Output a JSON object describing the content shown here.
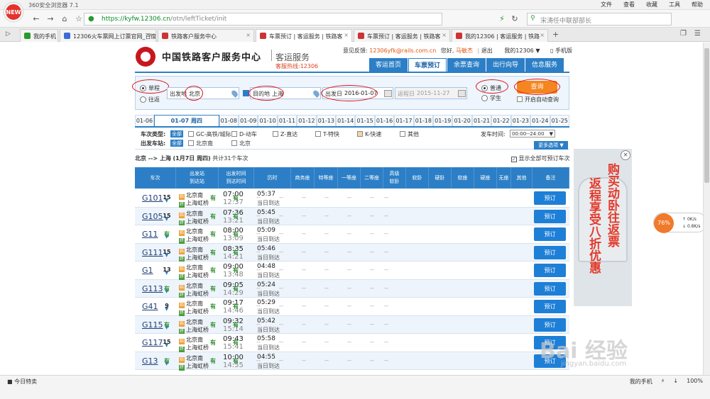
{
  "browser": {
    "title": "360安全浏览器 7.1",
    "logo_text": "NEW",
    "menu": [
      "文件",
      "查看",
      "收藏",
      "工具",
      "帮助"
    ],
    "url_host": "https://kyfw.12306.cn",
    "url_path": "/otn/leftTicket/init",
    "search_placeholder": "宋涛任中联部部长",
    "tabs": [
      {
        "label": "我的手机"
      },
      {
        "label": "12306火车票网上订票官网_百度"
      },
      {
        "label": "铁路客户服务中心"
      },
      {
        "label": "车票预订 | 客运服务 | 铁路客"
      },
      {
        "label": "车票预订 | 客运服务 | 铁路客"
      },
      {
        "label": "我的12306 | 客运服务 | 铁路"
      }
    ]
  },
  "site": {
    "name": "中国铁路客户服务中心",
    "sub": "客运服务",
    "hotline": "客服热线:12306",
    "feedback_label": "意见反馈:",
    "feedback_email": "12306yfk@rails.com.cn",
    "greeting": "您好,",
    "user": "马敏杰",
    "logout": "退出",
    "my12306": "我的12306",
    "mobile": "手机版",
    "nav": [
      "客运首页",
      "车票预订",
      "余票查询",
      "出行向导",
      "信息服务"
    ]
  },
  "search": {
    "oneway": "单程",
    "roundtrip": "往返",
    "from_label": "出发地",
    "from_value": "北京",
    "to_label": "目的地",
    "to_value": "上海",
    "date_label": "出发日",
    "date_value": "2016-01-07",
    "return_label": "返程日",
    "return_value": "2015-11-27",
    "normal": "普通",
    "student": "学生",
    "query": "查询",
    "auto_query": "开启自动查询"
  },
  "dates": [
    "01-06",
    "01-07 周四",
    "01-08",
    "01-09",
    "01-10",
    "01-11",
    "01-12",
    "01-13",
    "01-14",
    "01-15",
    "01-16",
    "01-17",
    "01-18",
    "01-19",
    "01-20",
    "01-21",
    "01-22",
    "01-23",
    "01-24",
    "01-25"
  ],
  "filters": {
    "type_label": "车次类型:",
    "all": "全部",
    "types": [
      "GC-高铁/城际",
      "D-动车",
      "Z-直达",
      "T-特快",
      "K-快速",
      "其他"
    ],
    "station_label": "出发车站:",
    "stations": [
      "北京南",
      "北京"
    ],
    "time_label": "发车时间:",
    "time_value": "00:00--24:00",
    "more": "更多选项"
  },
  "summary": {
    "route": "北京 --> 上海",
    "date": "(1月7日 周四)",
    "count": "共计31个车次",
    "show_all": "显示全部可预订车次"
  },
  "table": {
    "headers": [
      "车次",
      "出发站\n到达站",
      "出发时间\n到达时间",
      "历时",
      "商务座",
      "特等座",
      "一等座",
      "二等座",
      "高级\n软卧",
      "软卧",
      "硬卧",
      "软座",
      "硬座",
      "无座",
      "其他",
      "备注"
    ],
    "book_label": "预订",
    "rows": [
      {
        "no": "G101",
        "from": "北京南",
        "to": "上海虹桥",
        "dep": "07:00",
        "arr": "12:37",
        "dur": "05:37",
        "dur_sub": "当日到达",
        "seats": [
          "15",
          "--",
          "有",
          "有",
          "--",
          "--",
          "--",
          "--",
          "--",
          "--",
          "--"
        ]
      },
      {
        "no": "G105",
        "from": "北京南",
        "to": "上海虹桥",
        "dep": "07:36",
        "arr": "13:21",
        "dur": "05:45",
        "dur_sub": "当日到达",
        "seats": [
          "15",
          "--",
          "有",
          "有",
          "--",
          "--",
          "--",
          "--",
          "--",
          "--",
          "--"
        ]
      },
      {
        "no": "G11",
        "from": "北京南",
        "to": "上海虹桥",
        "dep": "08:00",
        "arr": "13:09",
        "dur": "05:09",
        "dur_sub": "当日到达",
        "seats": [
          "有",
          "--",
          "有",
          "有",
          "--",
          "--",
          "--",
          "--",
          "--",
          "--",
          "--"
        ]
      },
      {
        "no": "G111",
        "from": "北京南",
        "to": "上海虹桥",
        "dep": "08:35",
        "arr": "14:21",
        "dur": "05:46",
        "dur_sub": "当日到达",
        "seats": [
          "15",
          "--",
          "有",
          "有",
          "--",
          "--",
          "--",
          "--",
          "--",
          "--",
          "--"
        ]
      },
      {
        "no": "G1",
        "from": "北京南",
        "to": "上海虹桥",
        "dep": "09:00",
        "arr": "13:48",
        "dur": "04:48",
        "dur_sub": "当日到达",
        "seats": [
          "13",
          "--",
          "有",
          "有",
          "--",
          "--",
          "--",
          "--",
          "--",
          "--",
          "--"
        ]
      },
      {
        "no": "G113",
        "from": "北京南",
        "to": "上海虹桥",
        "dep": "09:05",
        "arr": "14:29",
        "dur": "05:24",
        "dur_sub": "当日到达",
        "seats": [
          "有",
          "--",
          "有",
          "有",
          "--",
          "--",
          "--",
          "--",
          "--",
          "--",
          "--"
        ]
      },
      {
        "no": "G41",
        "from": "北京南",
        "to": "上海虹桥",
        "dep": "09:17",
        "arr": "14:46",
        "dur": "05:29",
        "dur_sub": "当日到达",
        "seats": [
          "9",
          "--",
          "有",
          "有",
          "--",
          "--",
          "--",
          "--",
          "--",
          "--",
          "--"
        ]
      },
      {
        "no": "G115",
        "from": "北京南",
        "to": "上海虹桥",
        "dep": "09:32",
        "arr": "15:14",
        "dur": "05:42",
        "dur_sub": "当日到达",
        "seats": [
          "有",
          "--",
          "有",
          "有",
          "--",
          "--",
          "--",
          "--",
          "--",
          "--",
          "--"
        ]
      },
      {
        "no": "G117",
        "from": "北京南",
        "to": "上海虹桥",
        "dep": "09:43",
        "arr": "15:41",
        "dur": "05:58",
        "dur_sub": "当日到达",
        "seats": [
          "15",
          "--",
          "有",
          "有",
          "--",
          "--",
          "--",
          "--",
          "--",
          "--",
          "--"
        ]
      },
      {
        "no": "G13",
        "from": "北京南",
        "to": "上海虹桥",
        "dep": "10:00",
        "arr": "14:55",
        "dur": "04:55",
        "dur_sub": "当日到达",
        "seats": [
          "有",
          "--",
          "有",
          "有",
          "--",
          "--",
          "--",
          "--",
          "--",
          "--",
          "--"
        ]
      }
    ]
  },
  "ad": {
    "line1": "购买动卧往返票",
    "line2": "返程享受八折优惠"
  },
  "speed_widget": {
    "percent": "76%",
    "up": "0K/s",
    "down": "0.8K/s"
  },
  "watermark": {
    "main": "Bai 经验",
    "sub": "jingyan.baidu.com"
  },
  "status": {
    "left": "今日特卖",
    "right": [
      "我的手机",
      "加速器",
      "下载",
      "100%"
    ]
  }
}
